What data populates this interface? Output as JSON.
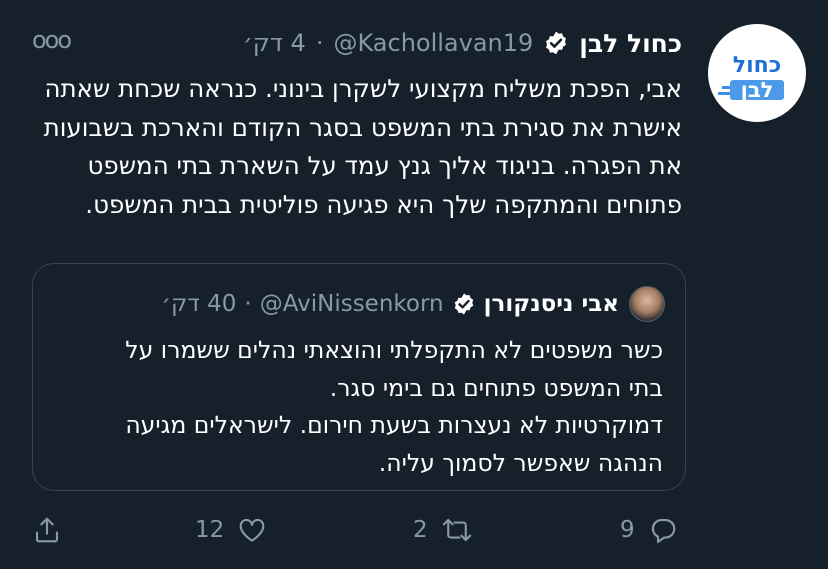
{
  "tweet": {
    "author_name": "כחול לבן",
    "handle": "@Kachollavan19",
    "separator": "·",
    "time": "4 דק׳",
    "more_label": "ooo",
    "text": "אבי, הפכת משליח מקצועי לשקרן בינוני. כנראה שכחת שאתה אישרת את סגירת בתי המשפט בסגר הקודם והארכת בשבועות את הפגרה. בניגוד אליך גנץ עמד על השארת בתי המשפט פתוחים והמתקפה שלך היא פגיעה פוליטית בבית המשפט.",
    "avatar_logo_line1": "כחול",
    "avatar_logo_line2": "לבן",
    "brand_color": "#1f6fd6",
    "verified_color": "#ffffff"
  },
  "quoted": {
    "author_name": "אבי ניסנקורן",
    "handle": "@AviNissenkorn",
    "separator": "·",
    "time": "40 דק׳",
    "line1": "כשר משפטים לא התקפלתי והוצאתי נהלים ששמרו על",
    "line2": "בתי המשפט פתוחים גם בימי סגר.",
    "line3": "דמוקרטיות לא נעצרות בשעת חירום. לישראלים מגיעה",
    "line4": "הנהגה שאפשר לסמוך עליה."
  },
  "actions": {
    "reply_count": "9",
    "retweet_count": "2",
    "like_count": "12",
    "icons": [
      "reply-icon",
      "retweet-icon",
      "like-icon",
      "share-icon"
    ]
  },
  "colors": {
    "background": "#15202b",
    "muted": "#8899a6",
    "border": "#38444d"
  }
}
